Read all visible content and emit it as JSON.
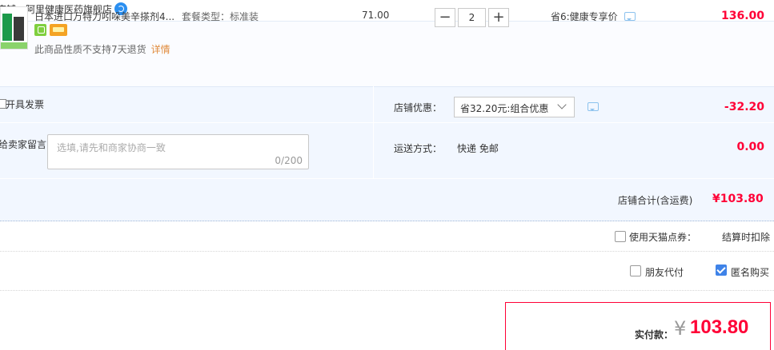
{
  "shop": {
    "label": "店铺：阿里健康医药旗舰店",
    "chat_icon": "wangwang-chat-icon"
  },
  "item": {
    "title": "日本进口万特力吲哚美辛搽剂4...",
    "sku": "套餐类型：标准装",
    "unit_price": "71.00",
    "quantity": "2",
    "minus_label": "−",
    "plus_label": "+",
    "promotion": "省6:健康专享价",
    "subtotal": "136.00",
    "return_note": "此商品性质不支持7天退货",
    "detail_link": "详情",
    "icons": [
      "service-badge-icon",
      "card-badge-icon"
    ]
  },
  "options": {
    "invoice_label": "开具发票",
    "message_label": "给卖家留言：",
    "message_placeholder": "选填,请先和商家协商一致",
    "message_count": "0/200",
    "coupon_label": "店铺优惠：",
    "coupon_value": "省32.20元:组合优惠",
    "coupon_amount": "-32.20",
    "shipping_label": "运送方式：",
    "shipping_value": "快递 免邮",
    "shipping_amount": "0.00"
  },
  "store_total": {
    "label": "店铺合计(含运费)",
    "value": "¥103.80"
  },
  "points": {
    "label": "使用天猫点券：",
    "note": "结算时扣除"
  },
  "pay_options": {
    "friend_label": "朋友代付",
    "anonymous_label": "匿名购买",
    "anonymous_checked": true,
    "accent": "#3f83e8"
  },
  "final": {
    "label": "实付款：",
    "currency": "¥",
    "value": "103.80",
    "accent": "#ff0036"
  }
}
